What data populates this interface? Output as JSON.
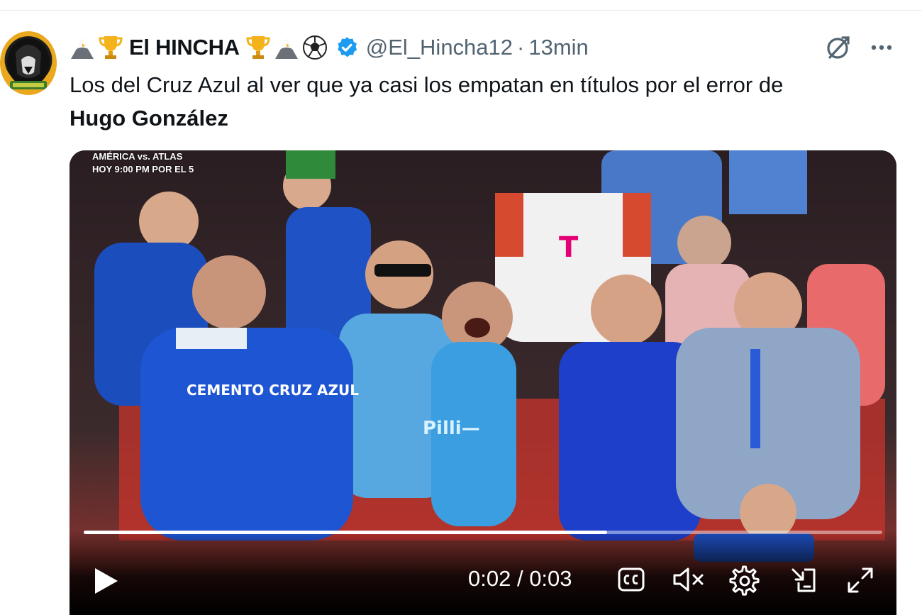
{
  "tweet": {
    "author": {
      "name": "El HINCHA",
      "handle": "@El_Hincha12",
      "separator": "·",
      "time": "13min",
      "verified": true,
      "emojis_before": [
        "eagle",
        "trophy"
      ],
      "emojis_after": [
        "trophy",
        "eagle",
        "soccer-ball"
      ]
    },
    "text": {
      "line1": "Los del Cruz Azul al ver que ya casi los empatan en títulos por el error de",
      "mention": "Hugo González"
    },
    "video": {
      "overlay_line1": "AMÉRICA vs. ATLAS",
      "overlay_line2": "HOY 9:00 PM POR EL 5",
      "current_time": "0:02",
      "duration": "0:03",
      "time_separator": " / ",
      "progress_fraction": 0.655,
      "jersey_text": "CEMENTO CRUZ AZUL"
    }
  },
  "colors": {
    "text_primary": "#0f1419",
    "text_secondary": "#536471",
    "verified_blue": "#1d9bf0",
    "divider": "#e6ecf0"
  },
  "icons": {
    "grok": "grok-icon",
    "more": "more-icon",
    "play": "play-icon",
    "cc": "closed-captions-icon",
    "mute": "volume-muted-icon",
    "settings": "gear-icon",
    "pip": "picture-in-picture-icon",
    "fullscreen": "fullscreen-icon"
  }
}
